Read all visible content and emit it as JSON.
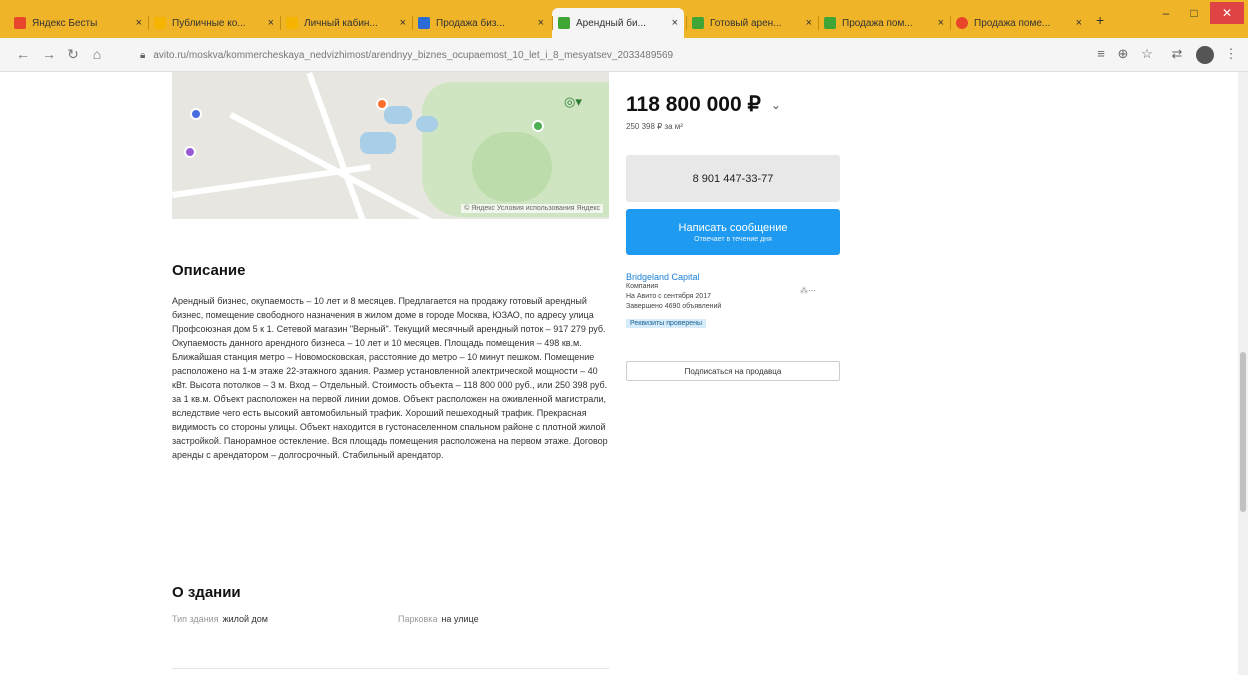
{
  "browser": {
    "tabs": [
      {
        "label": "Яндекс Бесты",
        "color": "#e8462b"
      },
      {
        "label": "Публичные ко...",
        "color": "#f5b400"
      },
      {
        "label": "Личный кабин...",
        "color": "#f5b400"
      },
      {
        "label": "Продажа биз...",
        "color": "#2b6bd6"
      },
      {
        "label": "Арендный би...",
        "color": "#3fa535"
      },
      {
        "label": "Готовый арен...",
        "color": "#3fa535"
      },
      {
        "label": "Продажа пом...",
        "color": "#3fa535"
      },
      {
        "label": "Продажа поме...",
        "color": "#e8462b"
      }
    ],
    "tab_close": "×",
    "new_tab": "+",
    "url": "avito.ru/moskva/kommercheskaya_nedvizhimost/arendnyy_biznes_ocupaemost_10_let_i_8_mesyatsev_2033489569",
    "min_glyph": "–",
    "max_glyph": "□",
    "close_glyph": "✕"
  },
  "map": {
    "copyright": "© Яндекс   Условия использования   Яндекс"
  },
  "description": {
    "title": "Описание",
    "text": "Арендный бизнес, окупаемость – 10 лет и 8 месяцев. Предлагается на продажу готовый арендный бизнес, помещение свободного назначения в жилом доме в городе Москва, ЮЗАО, по адресу улица Профсоюзная дом 5 к 1. Сетевой магазин \"Верный\". Текущий месячный арендный поток – 917 279 руб. Окупаемость данного арендного бизнеса – 10 лет и 10 месяцев. Площадь помещения – 498 кв.м. Ближайшая станция метро – Новомосковская, расстояние до метро – 10 минут пешком. Помещение расположено на 1-м этаже 22-этажного здания. Размер установленной электрической мощности – 40 кВт. Высота потолков – 3 м. Вход – Отдельный. Стоимость объекта – 118 800 000 руб., или 250 398 руб. за 1 кв.м. Объект расположен на первой линии домов. Объект расположен на оживленной магистрали, вследствие чего есть высокий автомобильный трафик. Хороший пешеходный трафик. Прекрасная видимость со стороны улицы. Объект находится в густонаселенном спальном районе с плотной жилой застройкой. Панорамное остекление. Вся площадь помещения расположена на первом этаже. Договор аренды с арендатором – долгосрочный. Стабильный арендатор."
  },
  "building": {
    "title": "О здании",
    "type_label": "Тип здания",
    "type_value": "жилой дом",
    "parking_label": "Парковка",
    "parking_value": "на улице"
  },
  "offer": {
    "price": "118 800 000 ₽",
    "price_chevron": "⌄",
    "per_sqm": "250 398 ₽ за м²",
    "phone": "8 901 447-33-77",
    "message_button": "Написать сообщение",
    "message_sub": "Отвечает в течение дня"
  },
  "seller": {
    "name": "Bridgeland Capital",
    "type": "Компания",
    "since": "На Авито с сентября 2017",
    "ads_done": "Завершено 4690 объявлений",
    "verified": "Реквизиты проверены",
    "subscribe_button": "Подписаться на продавца"
  }
}
